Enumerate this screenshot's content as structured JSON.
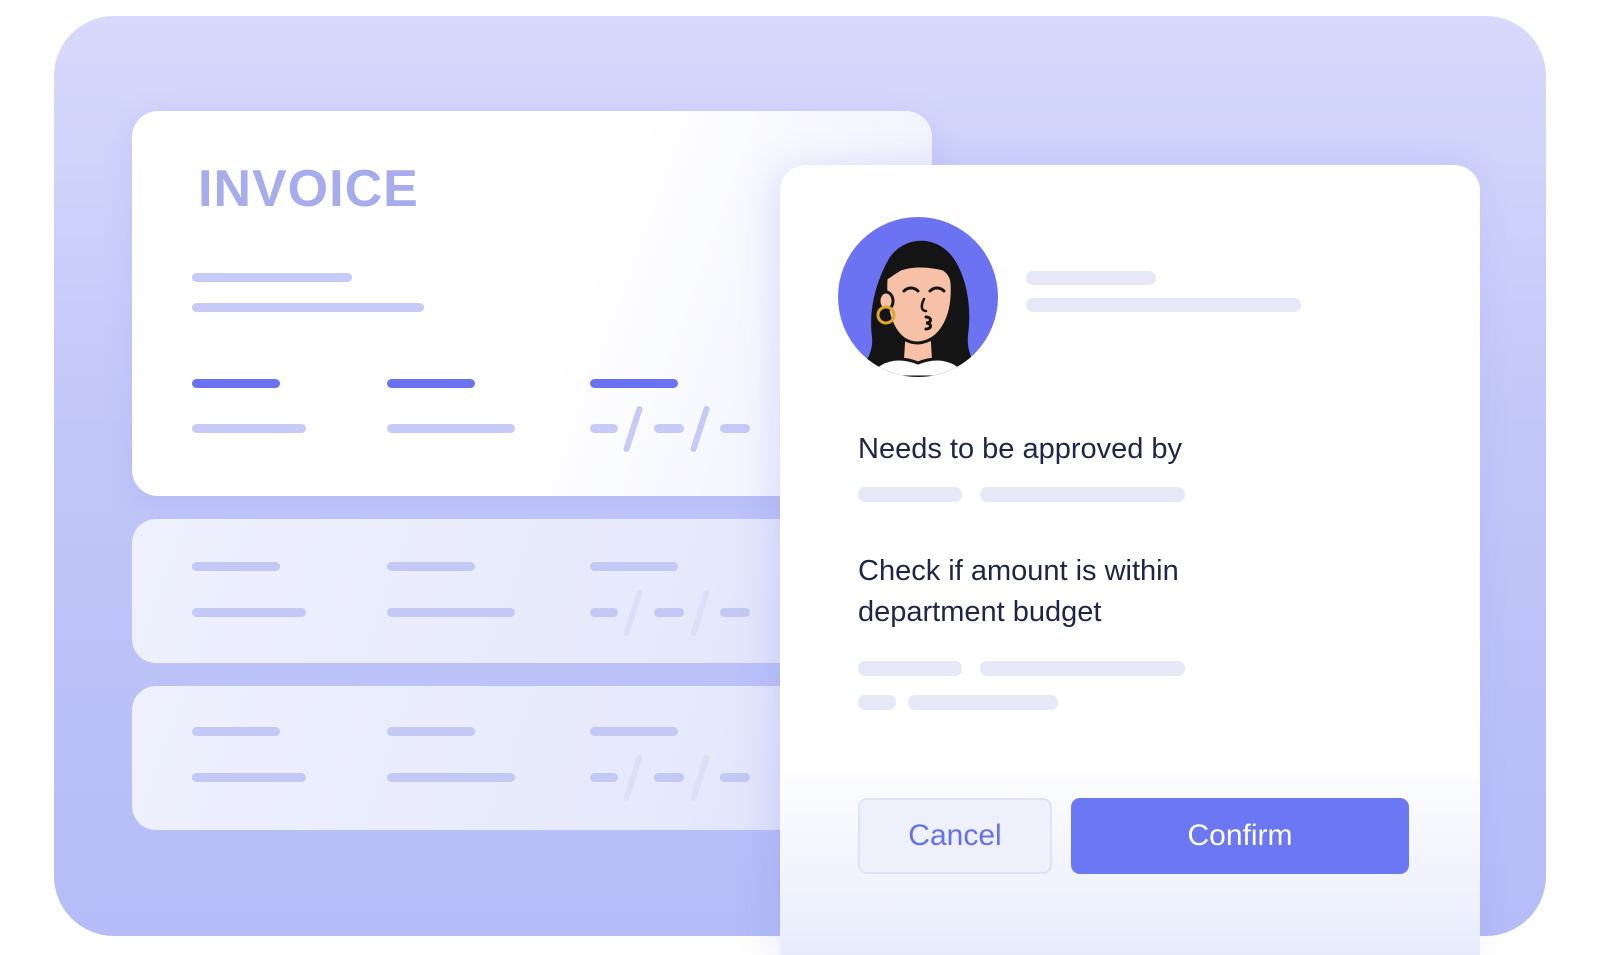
{
  "invoice": {
    "title": "INVOICE"
  },
  "approval_panel": {
    "approver_label": "Needs to be approved by",
    "check_label_line1": "Check if amount is within",
    "check_label_line2": "department budget",
    "cancel_label": "Cancel",
    "confirm_label": "Confirm"
  },
  "colors": {
    "accent": "#6c77f4",
    "background": "#c2c7f9",
    "invoice_title": "#a6acec",
    "text_dark": "#1f2547"
  },
  "icons": [
    "avatar-illustration"
  ]
}
